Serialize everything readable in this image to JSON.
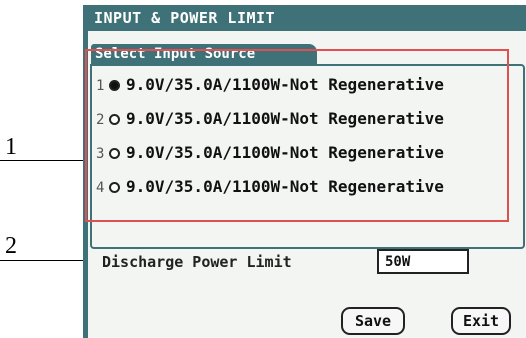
{
  "callouts": {
    "one": "1",
    "two": "2"
  },
  "header": {
    "title": "INPUT & POWER LIMIT"
  },
  "input_source": {
    "tab_label": "Select Input Source",
    "options": [
      {
        "number": "1",
        "label": "9.0V/35.0A/1100W-Not Regenerative",
        "selected": true
      },
      {
        "number": "2",
        "label": "9.0V/35.0A/1100W-Not Regenerative",
        "selected": false
      },
      {
        "number": "3",
        "label": "9.0V/35.0A/1100W-Not Regenerative",
        "selected": false
      },
      {
        "number": "4",
        "label": "9.0V/35.0A/1100W-Not Regenerative",
        "selected": false
      }
    ]
  },
  "discharge": {
    "label": "Discharge Power Limit",
    "value": "50W"
  },
  "buttons": {
    "save": "Save",
    "exit": "Exit"
  },
  "colors": {
    "frame": "#3e7278",
    "screen": "#f3f5f3",
    "highlight": "#e05050"
  }
}
